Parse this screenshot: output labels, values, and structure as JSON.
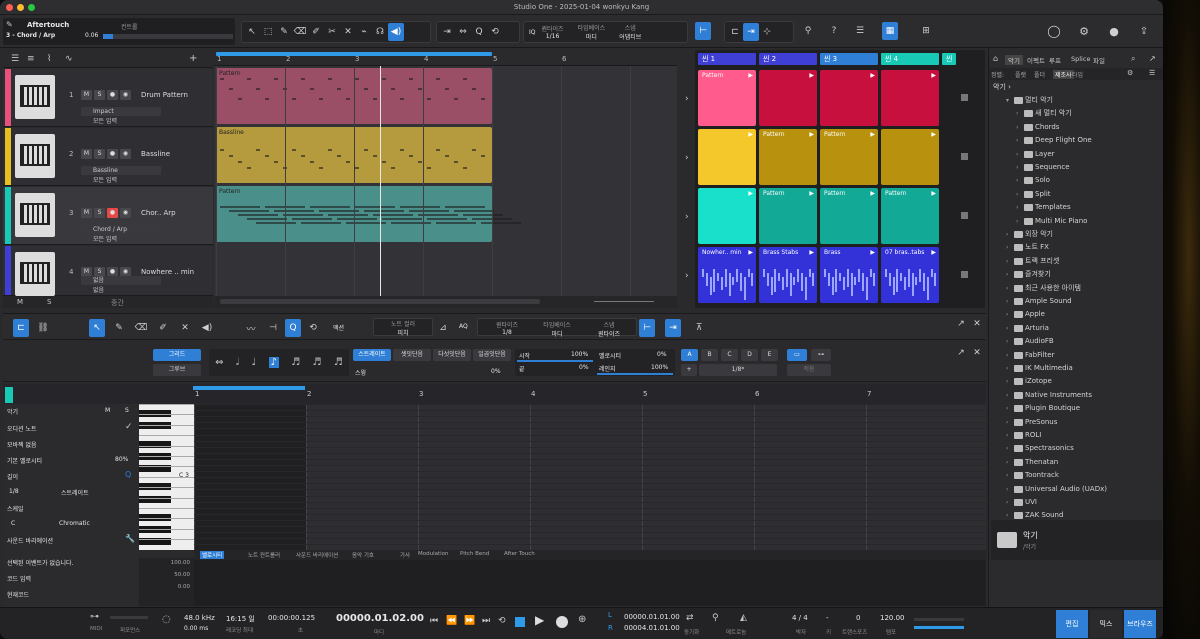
{
  "window": {
    "title": "Studio One - 2025-01-04 wonkyu Kang"
  },
  "inspector": {
    "param": "Aftertouch",
    "label": "컨트롤",
    "track": "3 - Chord / Arp",
    "value": "0.06"
  },
  "toolbar": {
    "quantize": {
      "label": "퀀타이즈",
      "value": "1/16"
    },
    "timebase": {
      "label": "타임베이스",
      "value": "마디"
    },
    "snap": {
      "label": "스냅",
      "value": "어댑티브"
    }
  },
  "tracks": [
    {
      "num": "1",
      "name": "Drum Pattern",
      "color": "#e8517b",
      "f1": "Impact",
      "f2": "모든 입력",
      "f3": "없음",
      "clip": "Pattern"
    },
    {
      "num": "2",
      "name": "Bassline",
      "color": "#e6c020",
      "f1": "Bassline",
      "f2": "모든 입력",
      "f3": "없음",
      "clip": "Bassline"
    },
    {
      "num": "3",
      "name": "Chor.. Arp",
      "color": "#18c9b6",
      "f1": "Chord / Arp",
      "f2": "모든 입력",
      "f3": "없음",
      "clip": "Pattern"
    },
    {
      "num": "4",
      "name": "Nowhere .. min",
      "color": "#3f3fd6",
      "f1": "없음",
      "f2": "없음",
      "f3": "Nowhere 160_Ir..1"
    }
  ],
  "tracklist_footer": {
    "m": "M",
    "s": "S",
    "mid": "중간"
  },
  "ruler": [
    "1",
    "2",
    "3",
    "4",
    "5",
    "6"
  ],
  "scenes": [
    {
      "label": "씬 1",
      "color": "#3f3fd6"
    },
    {
      "label": "씬 2",
      "color": "#3f3fd6"
    },
    {
      "label": "씬 3",
      "color": "#2f7fd6"
    },
    {
      "label": "씬 4",
      "color": "#18c9b6"
    },
    {
      "label": "씬",
      "color": "#18c9b6"
    }
  ],
  "pads": [
    [
      "Pattern",
      "",
      "",
      ""
    ],
    [
      "",
      "Pattern",
      "Pattern",
      ""
    ],
    [
      "",
      "Pattern",
      "Pattern",
      "Pattern"
    ],
    [
      "Nowher.. min",
      "Brass Stabs",
      "Brass",
      "07 bras..tabs"
    ]
  ],
  "browser": {
    "tabs": [
      "악기",
      "이펙트",
      "루프",
      "Splice",
      "파일"
    ],
    "filters": {
      "label": "정렬:",
      "items": [
        "플랫",
        "폴더",
        "제조사",
        "타입"
      ]
    },
    "path": "악기",
    "items": [
      {
        "level": 1,
        "text": "멀티 악기",
        "open": true
      },
      {
        "level": 2,
        "text": "새 멀티 악기"
      },
      {
        "level": 2,
        "text": "Chords"
      },
      {
        "level": 2,
        "text": "Deep Flight One"
      },
      {
        "level": 2,
        "text": "Layer"
      },
      {
        "level": 2,
        "text": "Sequence"
      },
      {
        "level": 2,
        "text": "Solo"
      },
      {
        "level": 2,
        "text": "Split"
      },
      {
        "level": 2,
        "text": "Templates"
      },
      {
        "level": 2,
        "text": "Multi Mic Piano"
      },
      {
        "level": 1,
        "text": "외장 악기"
      },
      {
        "level": 1,
        "text": "노트 FX"
      },
      {
        "level": 1,
        "text": "트랙 프리셋"
      },
      {
        "level": 1,
        "text": "즐겨찾기"
      },
      {
        "level": 1,
        "text": "최근 사용한 아이템"
      },
      {
        "level": 0,
        "text": "Ample Sound"
      },
      {
        "level": 0,
        "text": "Apple"
      },
      {
        "level": 0,
        "text": "Arturia"
      },
      {
        "level": 0,
        "text": "AudioFB"
      },
      {
        "level": 0,
        "text": "FabFilter"
      },
      {
        "level": 0,
        "text": "IK Multimedia"
      },
      {
        "level": 0,
        "text": "iZotope"
      },
      {
        "level": 0,
        "text": "Native Instruments"
      },
      {
        "level": 0,
        "text": "Plugin Boutique"
      },
      {
        "level": 0,
        "text": "PreSonus"
      },
      {
        "level": 0,
        "text": "ROLI"
      },
      {
        "level": 0,
        "text": "Spectrasonics"
      },
      {
        "level": 0,
        "text": "Thenatan"
      },
      {
        "level": 0,
        "text": "Toontrack"
      },
      {
        "level": 0,
        "text": "Universal Audio (UADx)"
      },
      {
        "level": 0,
        "text": "UVI"
      },
      {
        "level": 0,
        "text": "ZAK Sound"
      }
    ],
    "footer": {
      "title": "악기",
      "sub": "/악기"
    }
  },
  "editor": {
    "action": "액션",
    "note_color": {
      "label": "노트 컬러",
      "value": "피치"
    },
    "aq": "AQ",
    "quantize": {
      "label": "퀀타이즈",
      "value": "1/8"
    },
    "timebase": {
      "label": "타임베이스",
      "value": "마디"
    },
    "snap": {
      "label": "스냅",
      "value": "퀀타이즈"
    },
    "grid": "그리드",
    "groove": "그루브",
    "mode_tabs": [
      "스트레이트",
      "셋잇단음",
      "다섯잇단음",
      "일곱잇단음"
    ],
    "swing": {
      "label": "스윙",
      "value": "0%"
    },
    "start": {
      "label": "시작",
      "value": "100%"
    },
    "velocity": {
      "label": "벨로시티",
      "value": "0%"
    },
    "end": {
      "label": "끝",
      "value": "0%"
    },
    "range": {
      "label": "레인지",
      "value": "100%"
    },
    "letters": [
      "A",
      "B",
      "C",
      "D",
      "E"
    ],
    "plus": "+",
    "len": "1/8*",
    "apply": "적용",
    "ruler": [
      "1",
      "2",
      "3",
      "4",
      "5",
      "6",
      "7"
    ],
    "side": {
      "inst": "악기",
      "m": "M",
      "s": "S",
      "audition": "오디션 노트",
      "mod": "모바젝 없음",
      "base_vel_label": "기본 벨로시티",
      "base_vel": "80%",
      "len_label": "길이",
      "len": "1/8",
      "len_mode": "스트레이트",
      "scale_label": "스케일",
      "scale_root": "C",
      "scale": "Chromatic",
      "sound_var": "사운드 바리에이션",
      "no_event": "선택된 이벤트가 없습니다.",
      "chord_in": "코드 입력",
      "cur_chord": "현재코드"
    },
    "c3": "C 3",
    "vel_ticks": [
      "100.00",
      "50.00",
      "0.00"
    ],
    "lanes": [
      "벨로시티",
      "노트 컨트롤러",
      "사운드 바리에이션",
      "음악 기호",
      "가사",
      "Modulation",
      "Pitch Bend",
      "After Touch"
    ]
  },
  "transport": {
    "midi": "MIDI",
    "perf": "퍼포먼스",
    "rate": "48.0 kHz",
    "latency": "0.00 ms",
    "time": "16:15 일",
    "rec": "레코딩 최대",
    "seconds": "00:00:00.125",
    "sec_lbl": "초",
    "bars": "00000.01.02.00",
    "bars_lbl": "마디",
    "lpos": "00000.01.01.00",
    "rpos": "00004.01.01.00",
    "sync": "동기화",
    "metro": "메트로놈",
    "meter": "4 / 4",
    "meter_lbl": "박자",
    "key": "-",
    "key_lbl": "키",
    "transpose": "0",
    "transpose_lbl": "트랜스포즈",
    "tempo": "120.00",
    "tempo_lbl": "템포",
    "tabs": [
      "편집",
      "믹스",
      "브라우즈"
    ]
  },
  "colors": {
    "accent": "#2f7fd6"
  }
}
